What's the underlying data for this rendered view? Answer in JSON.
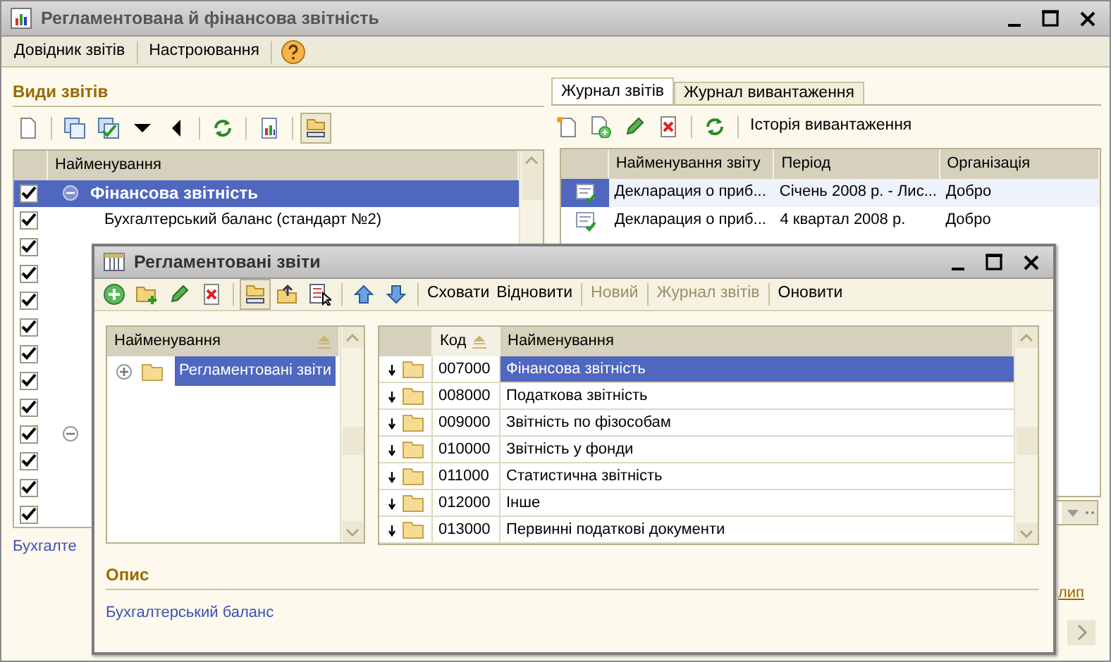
{
  "window": {
    "title": "Регламентована й фінансова звітність"
  },
  "menu": [
    {
      "label": "Довідник звітів"
    },
    {
      "label": "Настроювання"
    }
  ],
  "report_types": {
    "heading": "Види звітів",
    "view_mode_pressed": true,
    "column": "Найменування",
    "rows": [
      {
        "kind": "group",
        "checked": true,
        "expanded": true,
        "selected": true,
        "name": "Фінансова звітність"
      },
      {
        "kind": "item",
        "checked": true,
        "selected": false,
        "name": "Бухгалтерський баланс (стандарт №2)"
      },
      {
        "kind": "item",
        "checked": true,
        "selected": false
      },
      {
        "kind": "item",
        "checked": true,
        "selected": false
      },
      {
        "kind": "item",
        "checked": true,
        "selected": false
      },
      {
        "kind": "item",
        "checked": true,
        "selected": false
      },
      {
        "kind": "item",
        "checked": true,
        "selected": false
      },
      {
        "kind": "item",
        "checked": true,
        "selected": false
      },
      {
        "kind": "item",
        "checked": true,
        "selected": false
      },
      {
        "kind": "group",
        "checked": true,
        "expanded": true,
        "selected": false
      },
      {
        "kind": "item",
        "checked": true,
        "selected": false
      },
      {
        "kind": "item",
        "checked": true,
        "selected": false
      },
      {
        "kind": "item",
        "checked": true,
        "selected": false
      }
    ],
    "link": "Бухгалте"
  },
  "journal": {
    "tabs": [
      {
        "label": "Журнал звітів",
        "selected": true
      },
      {
        "label": "Журнал вивантаження",
        "selected": false
      }
    ],
    "toolbar_text": "Історія вивантаження",
    "columns": [
      "Найменування звіту",
      "Період",
      "Організація"
    ],
    "rows": [
      {
        "selected": true,
        "name": "Декларация о приб...",
        "period": "Січень 2008 р. - Лис...",
        "organization": "Добро"
      },
      {
        "selected": false,
        "name": "Декларация о приб...",
        "period": "4 квартал 2008 р.",
        "organization": "Добро"
      }
    ],
    "side_link": "лип"
  },
  "dialog": {
    "title": "Регламентовані звіти",
    "view_mode_pressed": true,
    "toolbar": [
      {
        "label": "Сховати",
        "disabled": false
      },
      {
        "label": "Відновити",
        "disabled": false
      },
      {
        "label": "Новий",
        "disabled": true
      },
      {
        "label": "Журнал звітів",
        "disabled": true
      },
      {
        "label": "Оновити",
        "disabled": false
      }
    ],
    "tree": {
      "column": "Найменування",
      "items": [
        {
          "name": "Регламентовані звіти",
          "expanded": false,
          "selected": true
        }
      ]
    },
    "table": {
      "columns": [
        "Код",
        "Найменування"
      ],
      "rows": [
        {
          "code": "007000",
          "name": "Фінансова звітність",
          "selected": true
        },
        {
          "code": "008000",
          "name": "Податкова звітність",
          "selected": false
        },
        {
          "code": "009000",
          "name": "Звітність по фізособам",
          "selected": false
        },
        {
          "code": "010000",
          "name": "Звітність у фонди",
          "selected": false
        },
        {
          "code": "011000",
          "name": "Статистична звітність",
          "selected": false
        },
        {
          "code": "012000",
          "name": "Інше",
          "selected": false
        },
        {
          "code": "013000",
          "name": "Первинні податкові документи",
          "selected": false
        }
      ]
    },
    "description": {
      "heading": "Опис",
      "text": "Бухгалтерський баланс"
    }
  }
}
